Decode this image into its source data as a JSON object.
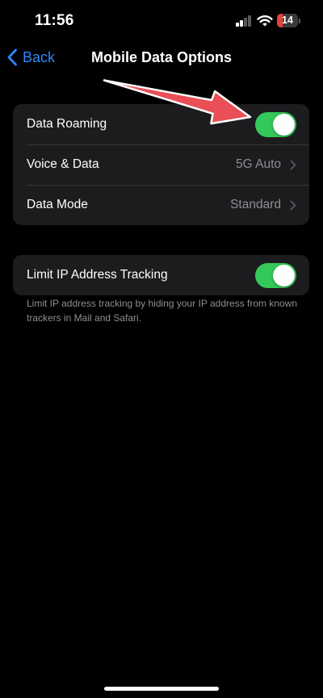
{
  "status_bar": {
    "time": "11:56",
    "battery_level": "14",
    "battery_fraction": 0.14,
    "signal_bars": 2,
    "signal_bars_total": 4,
    "battery_color": "#e5403a"
  },
  "nav": {
    "back_label": "Back",
    "title": "Mobile Data Options",
    "accent_color": "#2f86f7"
  },
  "settings_group": {
    "rows": [
      {
        "label": "Data Roaming",
        "toggle_on": true
      },
      {
        "label": "Voice & Data",
        "value": "5G Auto"
      },
      {
        "label": "Data Mode",
        "value": "Standard"
      }
    ]
  },
  "tracking_group": {
    "label": "Limit IP Address Tracking",
    "toggle_on": true,
    "footnote": "Limit IP address tracking by hiding your IP address from known trackers in Mail and Safari."
  },
  "annotation": {
    "type": "arrow",
    "color": "#ea4e57",
    "points_to": "Data Roaming toggle"
  },
  "toggle_on_color": "#34c759"
}
